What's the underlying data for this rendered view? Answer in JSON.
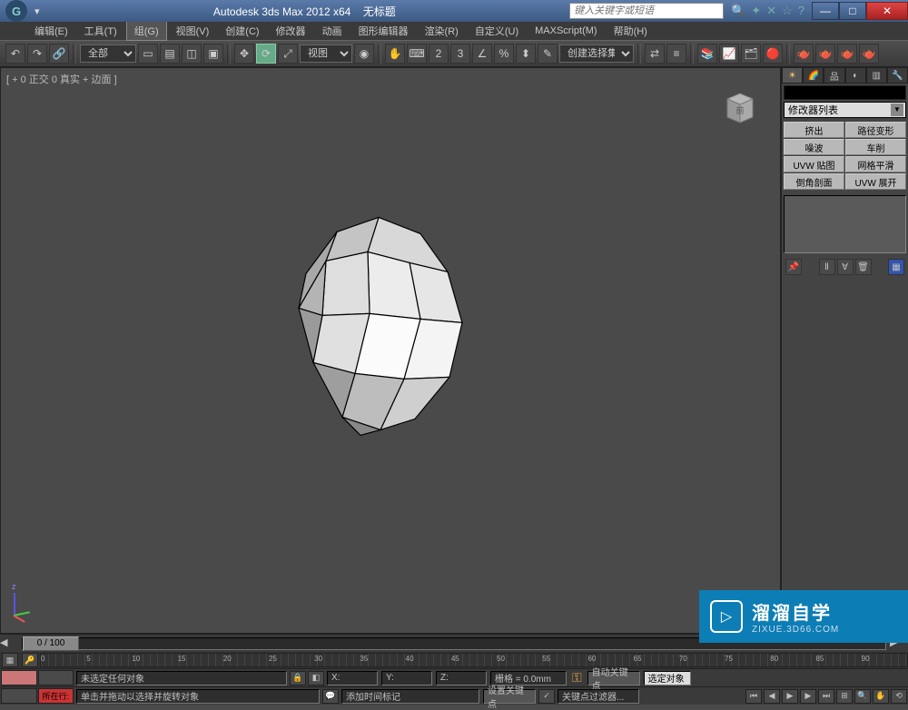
{
  "title": {
    "app": "Autodesk 3ds Max  2012 x64",
    "doc": "无标题",
    "search_placeholder": "键入关键字或短语"
  },
  "menus": [
    "编辑(E)",
    "工具(T)",
    "组(G)",
    "视图(V)",
    "创建(C)",
    "修改器",
    "动画",
    "图形编辑器",
    "渲染(R)",
    "自定义(U)",
    "MAXScript(M)",
    "帮助(H)"
  ],
  "toolbar": {
    "filter_label": "全部",
    "view_label": "视图",
    "named_sel": "创建选择集"
  },
  "viewport": {
    "label": "[ + 0 正交 0 真实 + 边面 ]",
    "cube_face": "前"
  },
  "cmd_panel": {
    "modifier_list": "修改器列表",
    "mods": [
      "挤出",
      "路径变形",
      "噪波",
      "车削",
      "UVW 贴图",
      "网格平滑",
      "倒角剖面",
      "UVW 展开"
    ]
  },
  "timeline": {
    "slider": "0 / 100",
    "ticks": [
      "0",
      "5",
      "10",
      "15",
      "20",
      "25",
      "30",
      "35",
      "40",
      "45",
      "50",
      "55",
      "60",
      "65",
      "70",
      "75",
      "80",
      "85",
      "90"
    ]
  },
  "status": {
    "row1_text": "未选定任何对象",
    "x": "X:",
    "y": "Y:",
    "z": "Z:",
    "grid": "栅格 = 0.0mm",
    "auto_key": "自动关键点",
    "sel_mode": "选定对象",
    "row2_label": "所在行:",
    "row2_text": "单击并拖动以选择并旋转对象",
    "add_time": "添加时间标记",
    "set_key": "设置关键点",
    "key_filter": "关键点过滤器..."
  },
  "watermark": {
    "cn": "溜溜自学",
    "url": "ZIXUE.3D66.COM"
  }
}
